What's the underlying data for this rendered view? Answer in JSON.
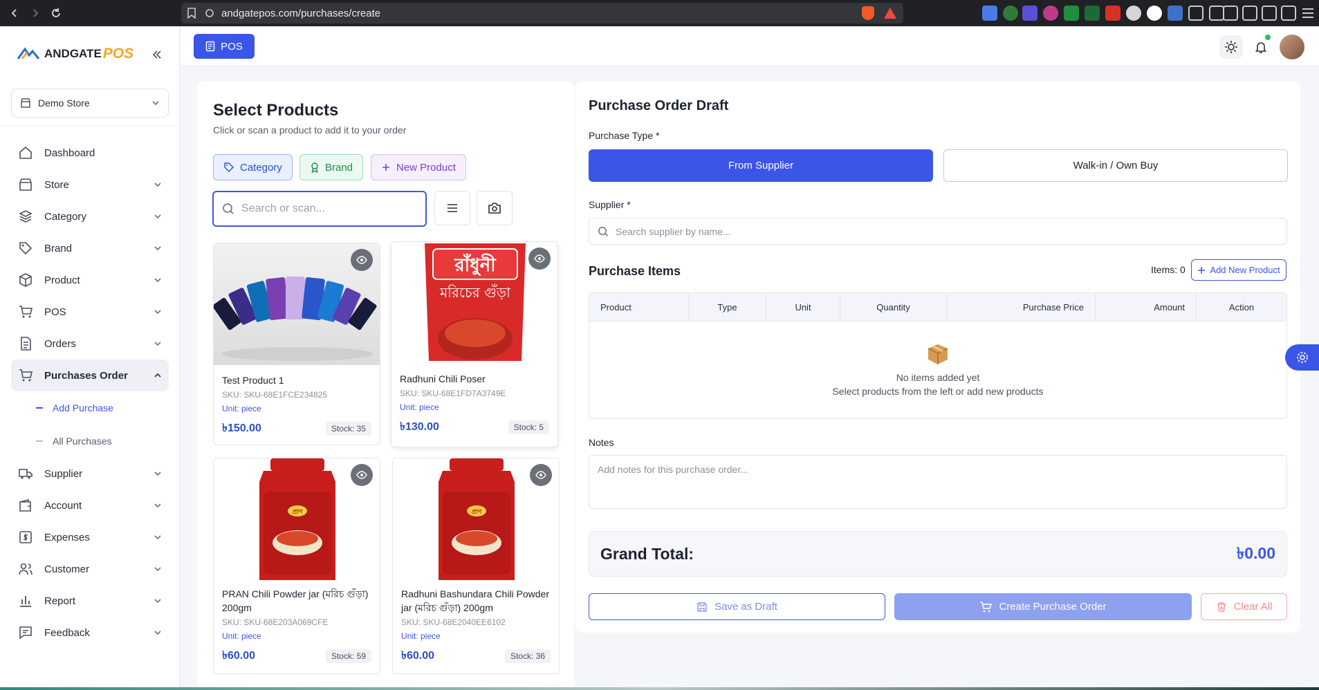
{
  "browser": {
    "url": "andgatepos.com/purchases/create"
  },
  "sidebar": {
    "logo_main": "ANDGATE",
    "logo_accent": "POS",
    "store": "Demo Store",
    "items": [
      {
        "label": "Dashboard",
        "icon": "home-icon"
      },
      {
        "label": "Store",
        "icon": "store-icon"
      },
      {
        "label": "Category",
        "icon": "layers-icon"
      },
      {
        "label": "Brand",
        "icon": "tag-icon"
      },
      {
        "label": "Product",
        "icon": "box-icon"
      },
      {
        "label": "POS",
        "icon": "cart-icon"
      },
      {
        "label": "Orders",
        "icon": "document-icon"
      },
      {
        "label": "Purchases Order",
        "icon": "cart-icon"
      },
      {
        "label": "Supplier",
        "icon": "truck-icon"
      },
      {
        "label": "Account",
        "icon": "wallet-icon"
      },
      {
        "label": "Expenses",
        "icon": "dollar-icon"
      },
      {
        "label": "Customer",
        "icon": "users-icon"
      },
      {
        "label": "Report",
        "icon": "chart-icon"
      },
      {
        "label": "Feedback",
        "icon": "message-icon"
      }
    ],
    "sub_items": [
      {
        "label": "Add Purchase"
      },
      {
        "label": "All Purchases"
      }
    ]
  },
  "topbar": {
    "pos_label": "POS"
  },
  "left": {
    "title": "Select Products",
    "subtitle": "Click or scan a product to add it to your order",
    "chips": {
      "category": "Category",
      "brand": "Brand",
      "new_product": "New Product"
    },
    "search_placeholder": "Search or scan...",
    "products": [
      {
        "name": "Test Product 1",
        "sku": "SKU: SKU-68E1FCE234825",
        "unit": "Unit: piece",
        "price": "৳150.00",
        "stock": "Stock: 35"
      },
      {
        "name": "Radhuni Chili Poser",
        "sku": "SKU: SKU-68E1FD7A3749E",
        "unit": "Unit: piece",
        "price": "৳130.00",
        "stock": "Stock: 5"
      },
      {
        "name": "PRAN Chili Powder jar (মরিচ গুঁড়া) 200gm",
        "sku": "SKU: SKU-68E203A069CFE",
        "unit": "Unit: piece",
        "price": "৳60.00",
        "stock": "Stock: 59"
      },
      {
        "name": "Radhuni Bashundara Chili Powder jar (মরিচ গুঁড়া) 200gm",
        "sku": "SKU: SKU-68E2040EE6102",
        "unit": "Unit: piece",
        "price": "৳60.00",
        "stock": "Stock: 36"
      }
    ],
    "product_image_text": {
      "radhuni_brand": "রাঁধুনী",
      "radhuni_product": "মরিচের গুঁড়া",
      "pran_brand": "প্রাণ"
    }
  },
  "right": {
    "title": "Purchase Order Draft",
    "purchase_type_label": "Purchase Type *",
    "type_supplier": "From Supplier",
    "type_walkin": "Walk-in / Own Buy",
    "supplier_label": "Supplier *",
    "supplier_placeholder": "Search supplier by name...",
    "items_title": "Purchase Items",
    "items_count": "Items: 0",
    "add_new_product": "Add New Product",
    "columns": [
      "Product",
      "Type",
      "Unit",
      "Quantity",
      "Purchase Price",
      "Amount",
      "Action"
    ],
    "empty_title": "No items added yet",
    "empty_sub": "Select products from the left or add new products",
    "notes_label": "Notes",
    "notes_placeholder": "Add notes for this purchase order...",
    "grand_total_label": "Grand Total:",
    "grand_total_value": "৳0.00",
    "save_draft": "Save as Draft",
    "create_order": "Create Purchase Order",
    "clear_all": "Clear All"
  },
  "colors": {
    "accent": "#3b55e6",
    "danger": "#ef8c8c"
  }
}
